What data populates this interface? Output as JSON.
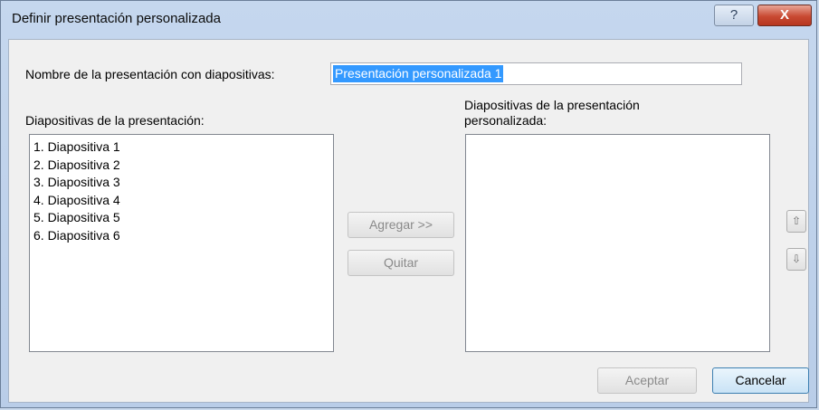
{
  "window": {
    "title": "Definir presentación personalizada",
    "help_label": "?",
    "close_label": "X"
  },
  "name_field": {
    "label": "Nombre de la presentación con diapositivas:",
    "value": "Presentación personalizada 1"
  },
  "left_panel": {
    "label": "Diapositivas de la presentación:",
    "items": [
      "1. Diapositiva 1",
      "2. Diapositiva 2",
      "3. Diapositiva 3",
      "4. Diapositiva 4",
      "5. Diapositiva 5",
      "6. Diapositiva 6"
    ]
  },
  "right_panel": {
    "label_line1": "Diapositivas de la presentación",
    "label_line2": "personalizada:",
    "items": []
  },
  "buttons": {
    "add": "Agregar >>",
    "remove": "Quitar",
    "move_up": "⇧",
    "move_down": "⇩",
    "ok": "Aceptar",
    "cancel": "Cancelar"
  },
  "colors": {
    "selection": "#3399ff",
    "close_button": "#c94a33",
    "default_button_border": "#3c7fb1"
  }
}
